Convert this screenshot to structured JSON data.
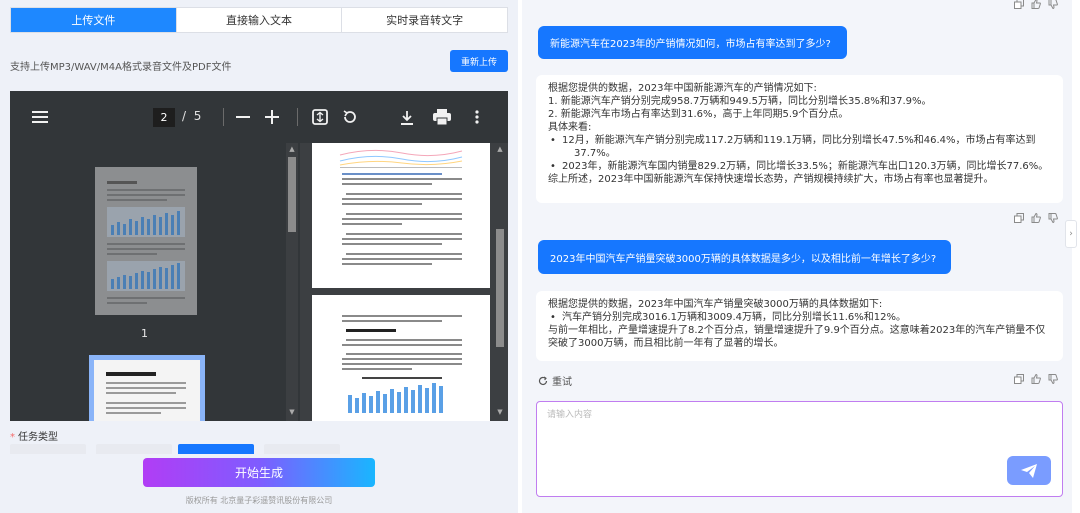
{
  "left": {
    "tabs": [
      {
        "label": "上传文件",
        "active": true
      },
      {
        "label": "直接输入文本",
        "active": false
      },
      {
        "label": "实时录音转文字",
        "active": false
      }
    ],
    "upload_hint": "支持上传MP3/WAV/M4A格式录音文件及PDF文件",
    "reupload_label": "重新上传",
    "pdf_viewer": {
      "current_page": "2",
      "separator": "/",
      "total_pages": "5",
      "thumbnail_label": "1"
    },
    "task_type_required": "*",
    "task_type_label": "任务类型",
    "generate_label": "开始生成",
    "copyright": "版权所有 北京量子彩遥赞讯股份有限公司"
  },
  "chat": {
    "messages": [
      {
        "role": "user",
        "text": "新能源汽车在2023年的产销情况如何，市场占有率达到了多少?"
      },
      {
        "role": "assistant",
        "lines": [
          {
            "type": "line",
            "text": "根据您提供的数据，2023年中国新能源汽车的产销情况如下:"
          },
          {
            "type": "line",
            "text": "1. 新能源汽车产销分别完成958.7万辆和949.5万辆，同比分别增长35.8%和37.9%。"
          },
          {
            "type": "line",
            "text": "2. 新能源汽车市场占有率达到31.6%，高于上年同期5.9个百分点。"
          },
          {
            "type": "line",
            "text": "具体来看:"
          },
          {
            "type": "bullet",
            "text": "12月，新能源汽车产销分别完成117.2万辆和119.1万辆，同比分别增长47.5%和46.4%，市场占有率达到"
          },
          {
            "type": "cont",
            "text": "37.7%。"
          },
          {
            "type": "bullet",
            "text": "2023年，新能源汽车国内销量829.2万辆，同比增长33.5%；新能源汽车出口120.3万辆，同比增长77.6%。"
          },
          {
            "type": "line",
            "text": "综上所述，2023年中国新能源汽车保持快速增长态势，产销规模持续扩大，市场占有率也显著提升。"
          }
        ]
      },
      {
        "role": "user",
        "text": "2023年中国汽车产销量突破3000万辆的具体数据是多少，以及相比前一年增长了多少?"
      },
      {
        "role": "assistant",
        "lines": [
          {
            "type": "line",
            "text": "根据您提供的数据，2023年中国汽车产销量突破3000万辆的具体数据如下:"
          },
          {
            "type": "bullet",
            "text": "汽车产销分别完成3016.1万辆和3009.4万辆，同比分别增长11.6%和12%。"
          },
          {
            "type": "line",
            "text": "与前一年相比，产量增速提升了8.2个百分点，销量增速提升了9.9个百分点。这意味着2023年的汽车产销量不仅"
          },
          {
            "type": "line",
            "text": "突破了3000万辆，而且相比前一年有了显著的增长。"
          }
        ]
      }
    ],
    "retry_label": "重试",
    "input_placeholder": "请输入内容"
  },
  "icons": {
    "copy": "copy-icon",
    "like": "thumbs-up-icon",
    "dislike": "thumbs-down-icon",
    "send": "paper-plane-icon",
    "expand": "chevron-right-icon"
  },
  "colors": {
    "accent": "#1677ff",
    "pdf_bg": "#323639",
    "gradient_start": "#b13df5",
    "gradient_end": "#19b6ff"
  }
}
